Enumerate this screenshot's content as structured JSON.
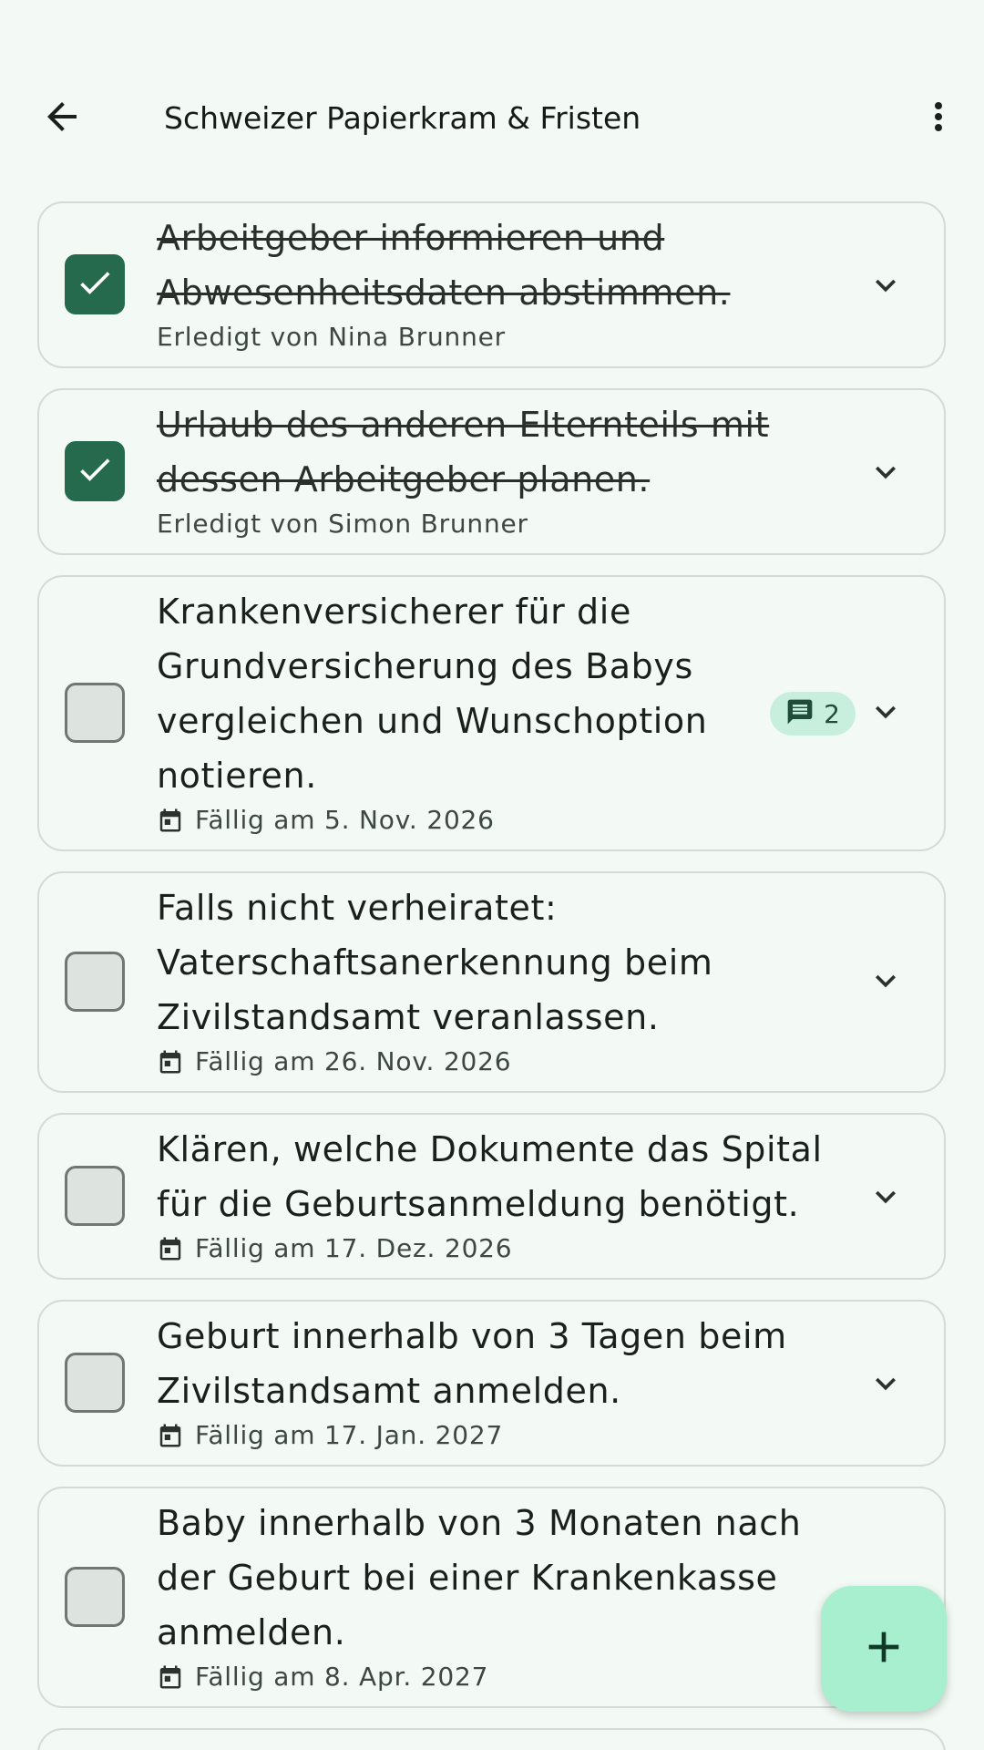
{
  "header": {
    "title": "Schweizer Papierkram & Fristen",
    "back_icon": "arrow-back-icon",
    "more_icon": "more-vert-icon"
  },
  "colors": {
    "background": "#f3faf5",
    "checked": "#266a4d",
    "badge": "#c8efdd",
    "fab": "#a8efd0"
  },
  "tasks": [
    {
      "lines": [
        "Arbeitgeber informieren und",
        "Abwesenheitsdaten abstimmen."
      ],
      "done": true,
      "meta": "Erledigt von Nina Brunner"
    },
    {
      "lines": [
        "Urlaub des anderen Elternteils mit",
        "dessen Arbeitgeber planen."
      ],
      "done": true,
      "meta": "Erledigt von Simon Brunner"
    },
    {
      "lines": [
        "Krankenversicherer für die",
        "Grundversicherung des Babys",
        "vergleichen und Wunschoption",
        "notieren."
      ],
      "done": false,
      "meta": "Fällig am 5. Nov. 2026",
      "comments": "2"
    },
    {
      "lines": [
        "Falls nicht verheiratet:",
        "Vaterschaftsanerkennung beim",
        "Zivilstandsamt veranlassen."
      ],
      "done": false,
      "meta": "Fällig am 26. Nov. 2026"
    },
    {
      "lines": [
        "Klären, welche Dokumente das Spital",
        "für die Geburtsanmeldung benötigt."
      ],
      "done": false,
      "meta": "Fällig am 17. Dez. 2026"
    },
    {
      "lines": [
        "Geburt innerhalb von 3 Tagen beim",
        "Zivilstandsamt anmelden."
      ],
      "done": false,
      "meta": "Fällig am 17. Jan. 2027"
    },
    {
      "lines": [
        "Baby innerhalb von 3 Monaten nach",
        "der Geburt bei einer Krankenkasse",
        "anmelden."
      ],
      "done": false,
      "meta": "Fällig am 8. Apr. 2027"
    }
  ],
  "fab": {
    "icon": "add-icon"
  }
}
